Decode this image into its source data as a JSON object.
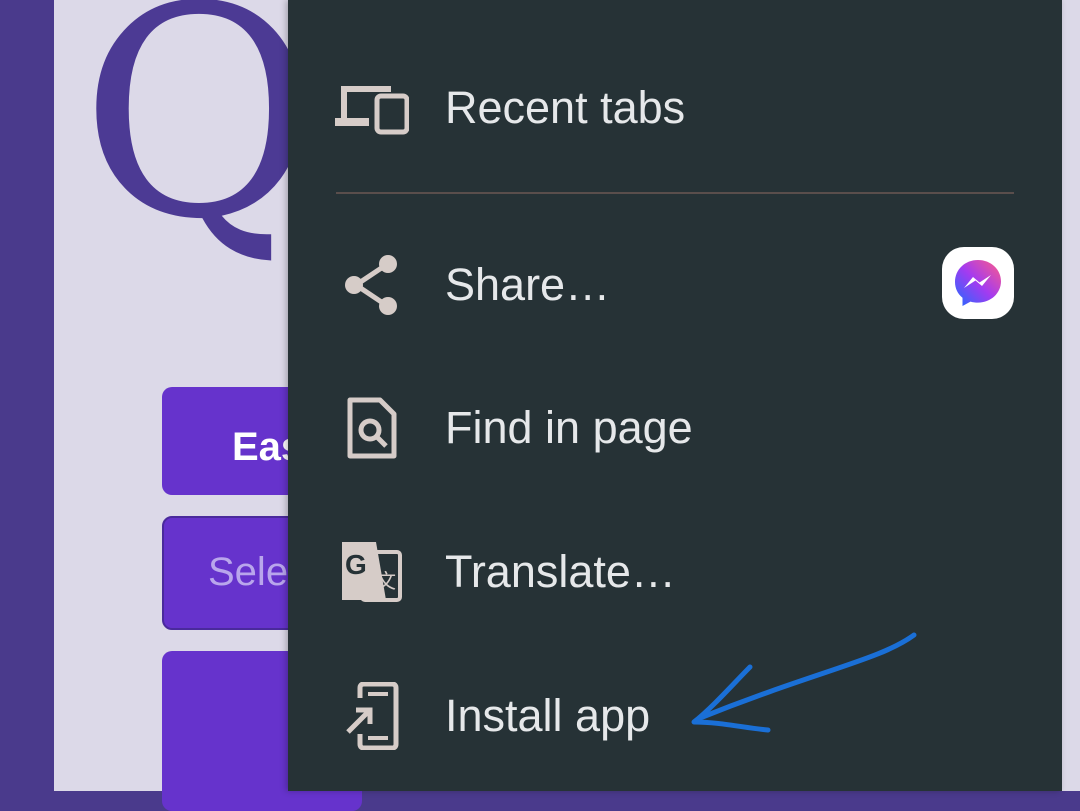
{
  "background_page": {
    "logo_letter": "Q",
    "easy_button_label": "Eas",
    "select_button_label": "Sele"
  },
  "menu": {
    "items": [
      {
        "label": "Recent tabs",
        "icon": "devices-icon"
      },
      {
        "label": "Share…",
        "icon": "share-icon",
        "share_target": "messenger-icon"
      },
      {
        "label": "Find in page",
        "icon": "find-in-page-icon"
      },
      {
        "label": "Translate…",
        "icon": "translate-icon"
      },
      {
        "label": "Install app",
        "icon": "install-app-icon"
      }
    ]
  },
  "colors": {
    "menu_bg": "#263236",
    "menu_text": "#e6e8ea",
    "icon_color": "#d6ccc8",
    "page_bg": "#dcd9e8",
    "accent_purple": "#6633cc",
    "annotation_blue": "#1a6fd6"
  }
}
